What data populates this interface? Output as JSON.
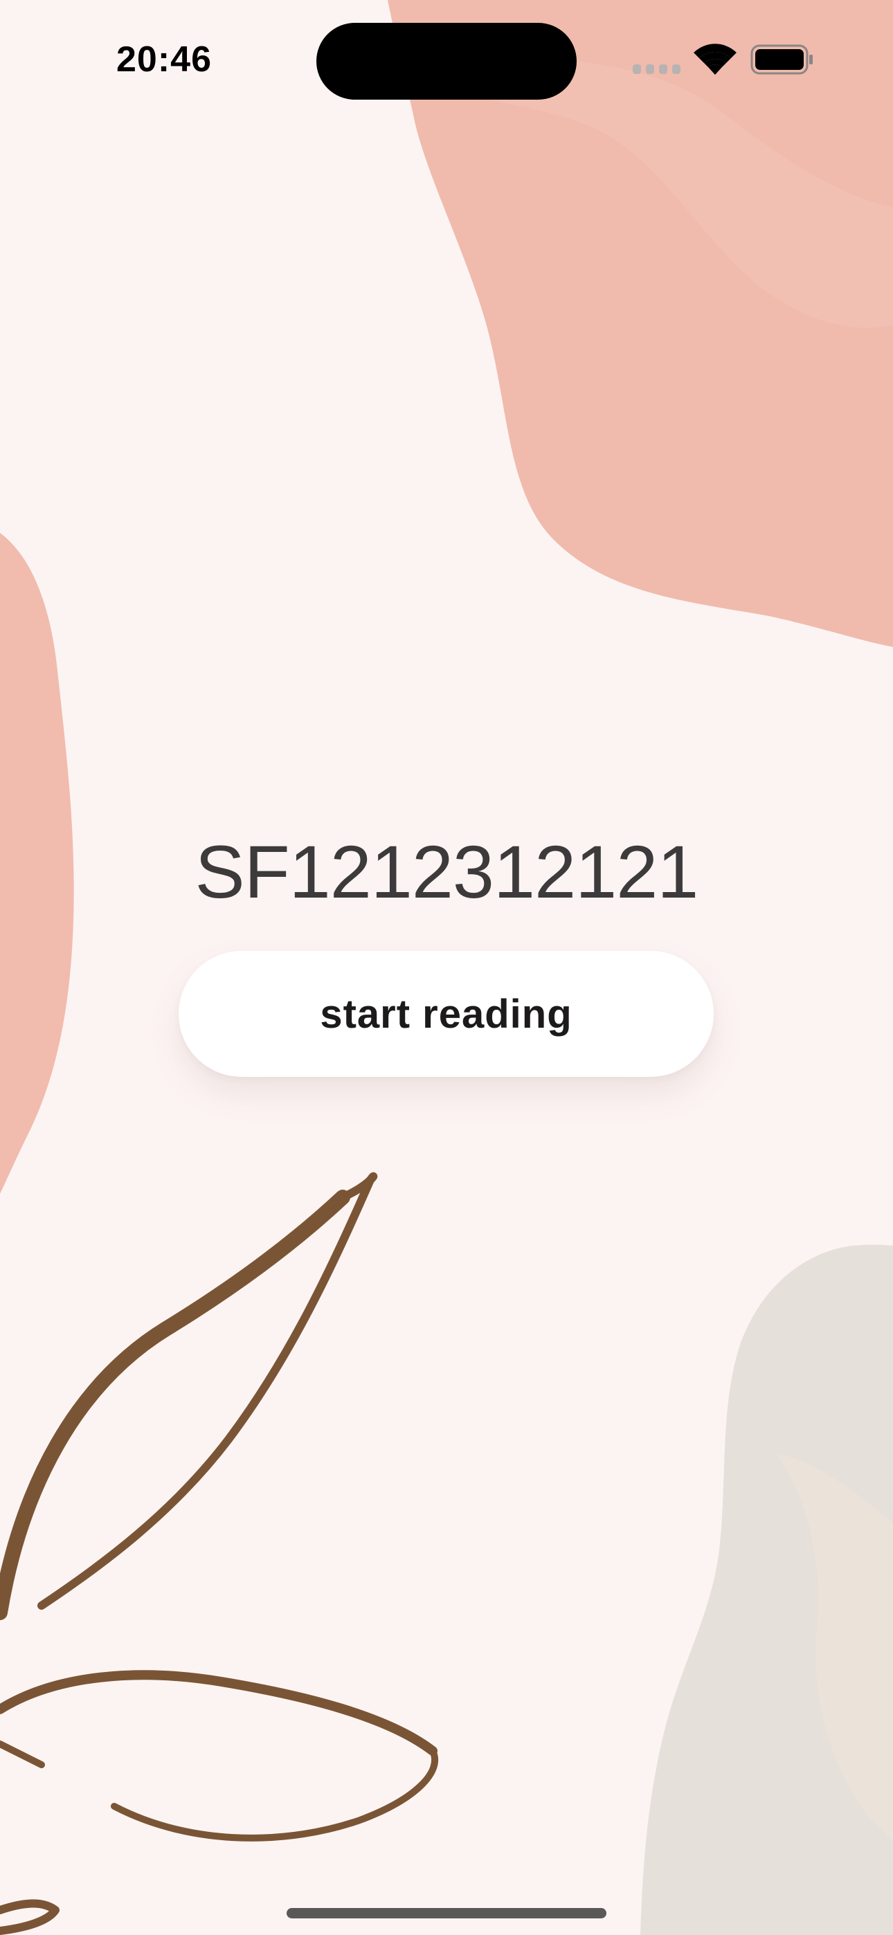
{
  "status_bar": {
    "time": "20:46",
    "signal_icon": "cellular-signal-icon",
    "wifi_icon": "wifi-icon",
    "battery_icon": "battery-icon"
  },
  "main": {
    "device_id": "SF1212312121",
    "start_button_label": "start reading"
  },
  "colors": {
    "background": "#fcf4f3",
    "blush_shape": "#efb5a6",
    "gray_shape": "#e6e0da",
    "leaf_stroke": "#7a5535",
    "text": "#3c3a3a",
    "button_bg": "#ffffff"
  }
}
